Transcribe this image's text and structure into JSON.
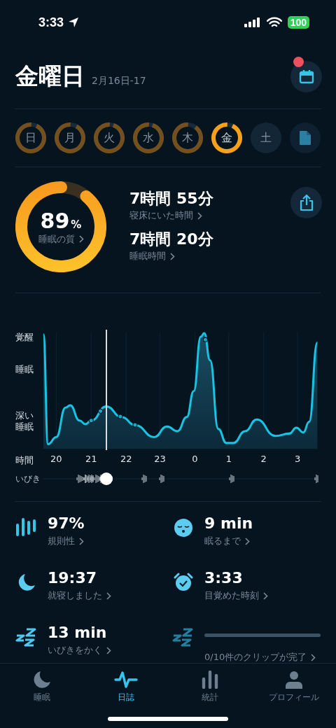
{
  "status_bar": {
    "time": "3:33",
    "battery": "100"
  },
  "header": {
    "title": "金曜日",
    "date": "2月16日-17",
    "calendar_badge": true
  },
  "days": [
    {
      "label": "日",
      "level": 0.93,
      "selected": false
    },
    {
      "label": "月",
      "level": 0.92,
      "selected": false
    },
    {
      "label": "火",
      "level": 0.95,
      "selected": false
    },
    {
      "label": "水",
      "level": 0.95,
      "selected": false
    },
    {
      "label": "木",
      "level": 0.9,
      "selected": false
    },
    {
      "label": "金",
      "level": 0.93,
      "selected": true
    },
    {
      "label": "土",
      "selected": false
    }
  ],
  "summary": {
    "score": "89",
    "unit": "%",
    "score_label": "睡眠の質",
    "level": 0.89,
    "stats": [
      {
        "value": "7時間 55分",
        "label": "寝床にいた時間"
      },
      {
        "value": "7時間 20分",
        "label": "睡眠時間"
      }
    ]
  },
  "graph": {
    "y_labels": [
      "覚醒",
      "睡眠",
      "深い睡眠"
    ],
    "x_label": "時間",
    "x_ticks": [
      "20",
      "21",
      "22",
      "23",
      "0",
      "1",
      "2",
      "3"
    ],
    "snore_label": "いびき"
  },
  "metrics": [
    {
      "kind": "regularity",
      "value": "97%",
      "label": "規則性"
    },
    {
      "kind": "onset",
      "value": "9 min",
      "label": "眠るまで"
    },
    {
      "kind": "bedtime",
      "value": "19:37",
      "label": "就寝しました"
    },
    {
      "kind": "wake",
      "value": "3:33",
      "label": "目覚めた時刻"
    },
    {
      "kind": "snore",
      "value": "13 min",
      "label": "いびきをかく"
    },
    {
      "kind": "clips",
      "label": "0/10件のクリップが完了"
    }
  ],
  "tabs": [
    {
      "kind": "sleep",
      "label": "睡眠",
      "selected": false
    },
    {
      "kind": "journal",
      "label": "日誌",
      "selected": true
    },
    {
      "kind": "stats",
      "label": "統計",
      "selected": false
    },
    {
      "kind": "profile",
      "label": "プロフィール",
      "selected": false
    }
  ]
}
